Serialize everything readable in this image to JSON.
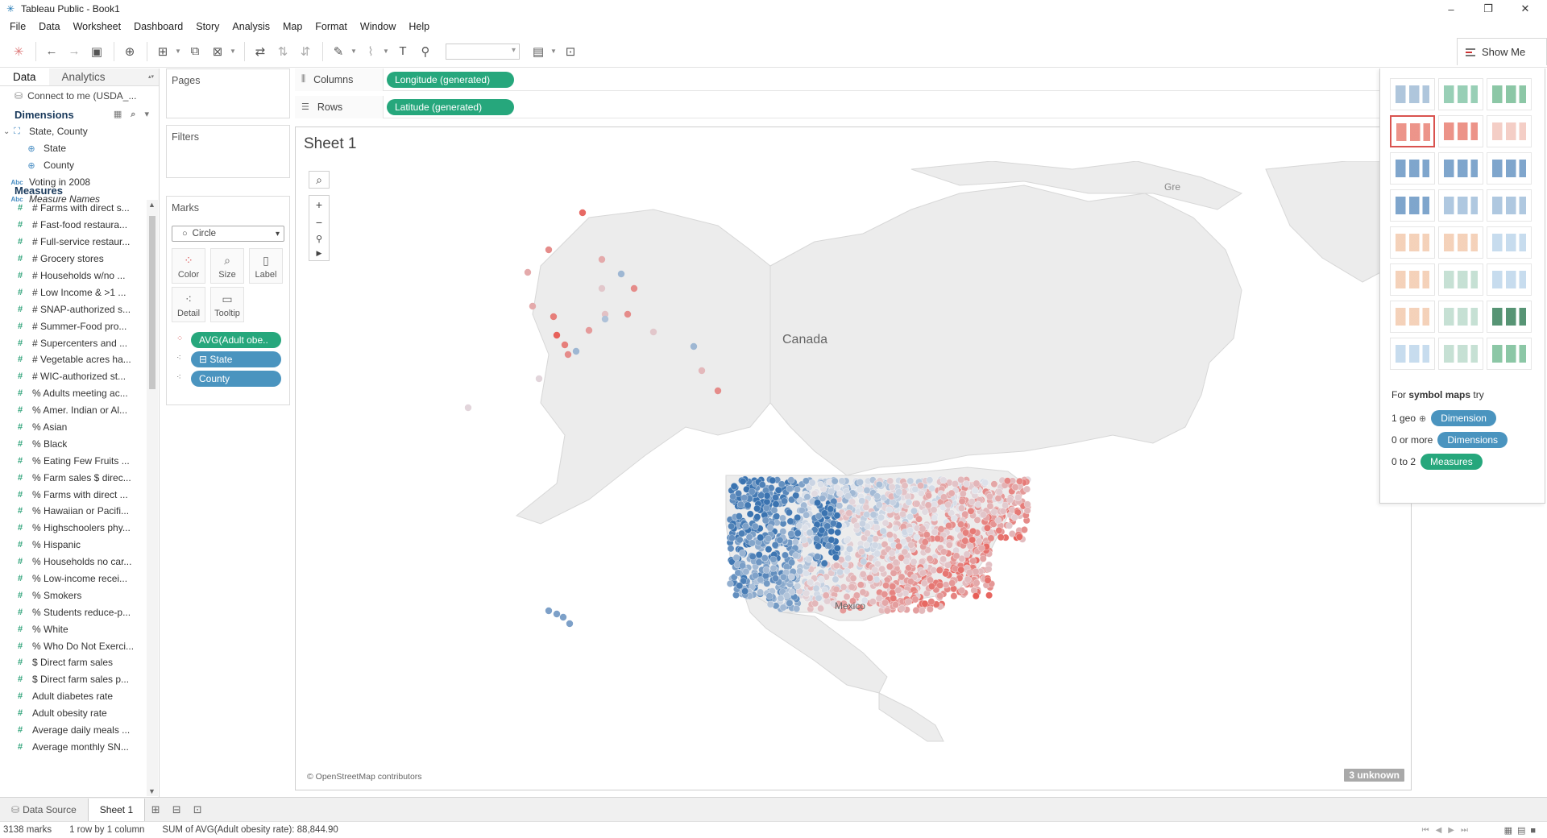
{
  "window": {
    "title": "Tableau Public - Book1",
    "controls": [
      "–",
      "❐",
      "✕"
    ]
  },
  "menu": [
    "File",
    "Data",
    "Worksheet",
    "Dashboard",
    "Story",
    "Analysis",
    "Map",
    "Format",
    "Window",
    "Help"
  ],
  "toolbar": {
    "show_me_label": "Show Me"
  },
  "data_pane": {
    "tab_data": "Data",
    "tab_analytics": "Analytics",
    "connection": "Connect to me (USDA_...",
    "dimensions_header": "Dimensions",
    "dimensions": [
      {
        "label": "State, County",
        "icon": "hierarchy-icon",
        "indent": 0
      },
      {
        "label": "State",
        "icon": "globe-icon",
        "indent": 1
      },
      {
        "label": "County",
        "icon": "globe-icon",
        "indent": 1
      },
      {
        "label": "Voting in 2008",
        "icon": "abc-icon",
        "indent": 0
      },
      {
        "label": "Measure Names",
        "icon": "abc-icon",
        "indent": 0,
        "italic": true
      }
    ],
    "measures_header": "Measures",
    "measures": [
      "# Farms with direct s...",
      "# Fast-food restaura...",
      "# Full-service restaur...",
      "# Grocery stores",
      "# Households w/no ...",
      "# Low Income & >1 ...",
      "# SNAP-authorized s...",
      "# Summer-Food pro...",
      "# Supercenters and ...",
      "# Vegetable acres ha...",
      "# WIC-authorized st...",
      "% Adults meeting ac...",
      "% Amer. Indian or Al...",
      "% Asian",
      "% Black",
      "% Eating Few Fruits ...",
      "% Farm sales $ direc...",
      "% Farms with direct ...",
      "% Hawaiian or Pacifi...",
      "% Highschoolers phy...",
      "% Hispanic",
      "% Households no car...",
      "% Low-income recei...",
      "% Smokers",
      "% Students reduce-p...",
      "% White",
      "% Who Do Not Exerci...",
      "$ Direct farm sales",
      "$ Direct farm sales p...",
      "Adult diabetes rate",
      "Adult obesity rate",
      "Average daily meals ...",
      "Average monthly SN..."
    ]
  },
  "cards": {
    "pages": "Pages",
    "filters": "Filters",
    "marks": "Marks",
    "mark_type": "Circle",
    "mark_buttons": [
      "Color",
      "Size",
      "Label",
      "Detail",
      "Tooltip"
    ],
    "mark_pills": [
      {
        "label": "AVG(Adult obe..",
        "color": "green"
      },
      {
        "label": "⊟ State",
        "color": "blue"
      },
      {
        "label": "County",
        "color": "blue"
      }
    ]
  },
  "shelves": {
    "columns_label": "Columns",
    "rows_label": "Rows",
    "columns_pill": "Longitude (generated)",
    "rows_pill": "Latitude (generated)"
  },
  "sheet": {
    "title": "Sheet 1",
    "map_labels": {
      "canada": "Canada",
      "mexico": "Mexico",
      "greenland": "Gre"
    },
    "attribution": "© OpenStreetMap contributors",
    "unknown_badge": "3 unknown"
  },
  "show_me": {
    "hint_prefix": "For ",
    "hint_bold": "symbol maps",
    "hint_suffix": " try",
    "rows": [
      {
        "qty": "1 geo",
        "pill": "Dimension",
        "color": "#4a94bf"
      },
      {
        "qty": "0 or more",
        "pill": "Dimensions",
        "color": "#4a94bf"
      },
      {
        "qty": "0 to 2",
        "pill": "Measures",
        "color": "#26a77c"
      }
    ]
  },
  "bottom_tabs": {
    "data_source": "Data Source",
    "sheet1": "Sheet 1"
  },
  "status": {
    "marks": "3138 marks",
    "dims": "1 row by 1 column",
    "sum": "SUM of AVG(Adult obesity rate): 88,844.90"
  },
  "colors": {
    "green_pill": "#26a77c",
    "blue_pill": "#4a94bf",
    "high": "#e8524a",
    "low": "#3a73b0"
  }
}
